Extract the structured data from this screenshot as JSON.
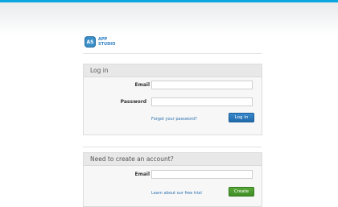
{
  "brand": {
    "badge": "AS",
    "line1": "APP",
    "line2": "STUDIO",
    "color": "#2e7ec0"
  },
  "login": {
    "title": "Log in",
    "email_label": "Email",
    "email_value": "",
    "password_label": "Password",
    "password_value": "",
    "forgot_link": "Forgot your password?",
    "login_button": "Log in"
  },
  "signup": {
    "title": "Need to create an account?",
    "email_label": "Email",
    "email_value": "",
    "trial_link": "Learn about our free trial",
    "create_button": "Create"
  },
  "colors": {
    "accent_bar": "#0aa6e0",
    "primary_button": "#1f67a8",
    "create_button": "#3d8a24"
  }
}
